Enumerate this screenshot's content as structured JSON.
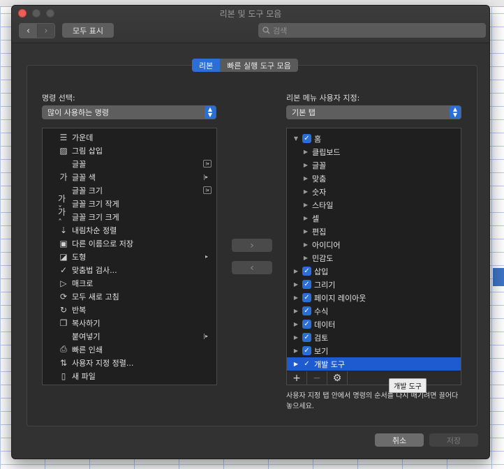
{
  "window": {
    "title": "리본 및 도구 모음"
  },
  "toolbar": {
    "show_all": "모두 표시",
    "search_placeholder": "검색"
  },
  "tabs": [
    {
      "label": "리본",
      "active": true
    },
    {
      "label": "빠른 실행 도구 모음",
      "active": false
    }
  ],
  "left": {
    "label": "명령 선택:",
    "dropdown": "많이 사용하는 명령",
    "commands": [
      {
        "label": "가운데",
        "icon": "align-center-icon",
        "glyph": "☰",
        "extra": ""
      },
      {
        "label": "그림 삽입",
        "icon": "insert-picture-icon",
        "glyph": "▨",
        "extra": ""
      },
      {
        "label": "글꼴",
        "icon": "",
        "glyph": "",
        "extra": "control"
      },
      {
        "label": "글꼴 색",
        "icon": "font-color-icon",
        "glyph": "가",
        "extra": "submenu"
      },
      {
        "label": "글꼴 크기",
        "icon": "",
        "glyph": "",
        "extra": "control"
      },
      {
        "label": "글꼴 크기 작게",
        "icon": "font-shrink-icon",
        "glyph": "가ˇ",
        "extra": ""
      },
      {
        "label": "글꼴 크기 크게",
        "icon": "font-grow-icon",
        "glyph": "가ˆ",
        "extra": ""
      },
      {
        "label": "내림차순 정렬",
        "icon": "sort-descending-icon",
        "glyph": "⇣",
        "extra": ""
      },
      {
        "label": "다른 이름으로 저장",
        "icon": "save-as-icon",
        "glyph": "▣",
        "extra": ""
      },
      {
        "label": "도형",
        "icon": "shapes-icon",
        "glyph": "◪",
        "extra": "arrow"
      },
      {
        "label": "맞춤법 검사...",
        "icon": "spell-check-icon",
        "glyph": "✓",
        "extra": ""
      },
      {
        "label": "매크로",
        "icon": "macro-play-icon",
        "glyph": "▷",
        "extra": ""
      },
      {
        "label": "모두 새로 고침",
        "icon": "refresh-all-icon",
        "glyph": "⟳",
        "extra": ""
      },
      {
        "label": "반복",
        "icon": "repeat-icon",
        "glyph": "↻",
        "extra": ""
      },
      {
        "label": "복사하기",
        "icon": "copy-icon",
        "glyph": "❐",
        "extra": ""
      },
      {
        "label": "붙여넣기",
        "icon": "",
        "glyph": "",
        "extra": "submenu"
      },
      {
        "label": "빠른 인쇄",
        "icon": "quick-print-icon",
        "glyph": "⎙",
        "extra": ""
      },
      {
        "label": "사용자 지정 정렬...",
        "icon": "custom-sort-icon",
        "glyph": "⇅",
        "extra": ""
      },
      {
        "label": "새 파일",
        "icon": "new-file-icon",
        "glyph": "▯",
        "extra": ""
      }
    ]
  },
  "move": {
    "add": "›",
    "remove": "‹"
  },
  "right": {
    "label": "리본 메뉴 사용자 지정:",
    "dropdown": "기본 탭",
    "tree": [
      {
        "label": "홈",
        "level": 0,
        "expanded": true,
        "checked": true
      },
      {
        "label": "클립보드",
        "level": 1,
        "expanded": false,
        "checked": null
      },
      {
        "label": "글꼴",
        "level": 1,
        "expanded": false,
        "checked": null
      },
      {
        "label": "맞춤",
        "level": 1,
        "expanded": false,
        "checked": null
      },
      {
        "label": "숫자",
        "level": 1,
        "expanded": false,
        "checked": null
      },
      {
        "label": "스타일",
        "level": 1,
        "expanded": false,
        "checked": null
      },
      {
        "label": "셀",
        "level": 1,
        "expanded": false,
        "checked": null
      },
      {
        "label": "편집",
        "level": 1,
        "expanded": false,
        "checked": null
      },
      {
        "label": "아이디어",
        "level": 1,
        "expanded": false,
        "checked": null
      },
      {
        "label": "민감도",
        "level": 1,
        "expanded": false,
        "checked": null
      },
      {
        "label": "삽입",
        "level": 0,
        "expanded": false,
        "checked": true
      },
      {
        "label": "그리기",
        "level": 0,
        "expanded": false,
        "checked": true
      },
      {
        "label": "페이지 레이아웃",
        "level": 0,
        "expanded": false,
        "checked": true
      },
      {
        "label": "수식",
        "level": 0,
        "expanded": false,
        "checked": true
      },
      {
        "label": "데이터",
        "level": 0,
        "expanded": false,
        "checked": true
      },
      {
        "label": "검토",
        "level": 0,
        "expanded": false,
        "checked": true
      },
      {
        "label": "보기",
        "level": 0,
        "expanded": false,
        "checked": true
      },
      {
        "label": "개발 도구",
        "level": 0,
        "expanded": false,
        "checked": true,
        "selected": true
      }
    ],
    "tooltip": "개발 도구",
    "hint": "사용자 지정 탭 안에서 명령의 순서를 다시 매기려면 끌어다 놓으세요."
  },
  "buttons": {
    "cancel": "취소",
    "save": "저장"
  },
  "colors": {
    "accent": "#2b6fd6",
    "selection": "#1f5bd0"
  }
}
